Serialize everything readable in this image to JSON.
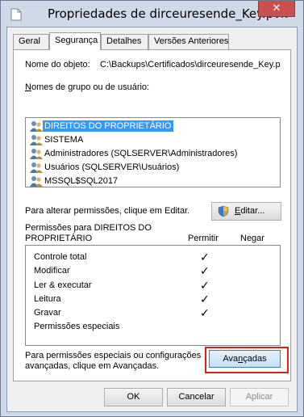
{
  "window": {
    "title": "Propriedades de dirceuresende_Key.pvk",
    "close_glyph": "✕",
    "close_color": "#c75050",
    "frame_color": "#cfd9e8"
  },
  "tabs": [
    {
      "label": "Geral"
    },
    {
      "label": "Segurança"
    },
    {
      "label": "Detalhes"
    },
    {
      "label": "Versões Anteriores"
    }
  ],
  "object": {
    "label": "Nome do objeto:",
    "value": "C:\\Backups\\Certificados\\dirceuresende_Key.p"
  },
  "groups": {
    "label_first": "N",
    "label_rest": "omes de grupo ou de usuário:",
    "items": [
      {
        "label": "DIREITOS DO PROPRIETÁRIO",
        "icon": "users-icon",
        "selected": true
      },
      {
        "label": "SISTEMA",
        "icon": "users-icon",
        "selected": false
      },
      {
        "label": "Administradores (SQLSERVER\\Administradores)",
        "icon": "users-icon",
        "selected": false
      },
      {
        "label": "Usuários (SQLSERVER\\Usuários)",
        "icon": "users-icon",
        "selected": false
      },
      {
        "label": "MSSQL$SQL2017",
        "icon": "users-icon",
        "selected": false
      }
    ]
  },
  "edit": {
    "hint": "Para alterar permissões, clique em Editar.",
    "button_first": "E",
    "button_rest": "ditar...",
    "icon": "shield-icon"
  },
  "permissions": {
    "label_line1": "Permissões para DIREITOS DO",
    "label_line2": "PROPRIETÁRIO",
    "allow_header": "Permitir",
    "deny_header": "Negar",
    "rows": [
      {
        "name": "Controle total",
        "allow": "✓"
      },
      {
        "name": "Modificar",
        "allow": "✓"
      },
      {
        "name": "Ler & executar",
        "allow": "✓"
      },
      {
        "name": "Leitura",
        "allow": "✓"
      },
      {
        "name": "Gravar",
        "allow": "✓"
      },
      {
        "name": "Permissões especiais",
        "allow": ""
      }
    ]
  },
  "advanced": {
    "hint_line1": "Para permissões especiais ou configurações",
    "hint_line2": "avançadas, clique em Avançadas.",
    "button_first": "Ava",
    "button_underline": "n",
    "button_rest": "çadas",
    "highlight_color": "#d32020"
  },
  "footer": {
    "ok": "OK",
    "cancel": "Cancelar",
    "apply": "Aplicar"
  }
}
